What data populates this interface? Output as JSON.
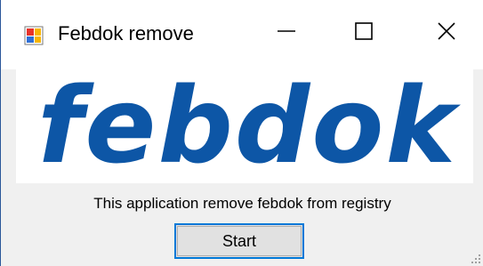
{
  "window": {
    "title": "Febdok remove",
    "icons": {
      "app": "application-icon",
      "minimize": "minimize-icon",
      "maximize": "maximize-icon",
      "close": "close-icon"
    }
  },
  "logo": {
    "text": "febdok",
    "color": "#0d56a6"
  },
  "main": {
    "description": "This application remove febdok from registry",
    "start_label": "Start"
  },
  "colors": {
    "button_border_focus": "#0078d7",
    "button_face": "#e1e1e1",
    "window_bg": "#f0f0f0"
  }
}
